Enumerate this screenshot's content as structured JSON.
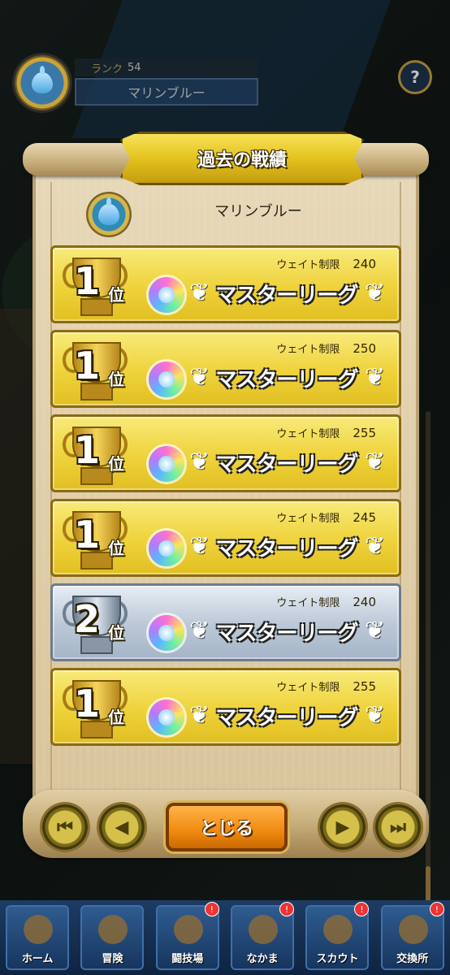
{
  "header": {
    "rank_label": "ランク",
    "rank_value": "54",
    "player_name": "マリンブルー",
    "help_label": "?"
  },
  "dialog": {
    "title": "過去の戦績",
    "player_name": "マリンブルー",
    "records": [
      {
        "rank": "1",
        "rank_suffix": "位",
        "weight_label": "ウェイト制限",
        "weight_value": "240",
        "league": "マスターリーグ",
        "tier": "gold"
      },
      {
        "rank": "1",
        "rank_suffix": "位",
        "weight_label": "ウェイト制限",
        "weight_value": "250",
        "league": "マスターリーグ",
        "tier": "gold"
      },
      {
        "rank": "1",
        "rank_suffix": "位",
        "weight_label": "ウェイト制限",
        "weight_value": "255",
        "league": "マスターリーグ",
        "tier": "gold"
      },
      {
        "rank": "1",
        "rank_suffix": "位",
        "weight_label": "ウェイト制限",
        "weight_value": "245",
        "league": "マスターリーグ",
        "tier": "gold"
      },
      {
        "rank": "2",
        "rank_suffix": "位",
        "weight_label": "ウェイト制限",
        "weight_value": "240",
        "league": "マスターリーグ",
        "tier": "silver"
      },
      {
        "rank": "1",
        "rank_suffix": "位",
        "weight_label": "ウェイト制限",
        "weight_value": "255",
        "league": "マスターリーグ",
        "tier": "gold"
      }
    ],
    "close_label": "とじる",
    "nav": {
      "first_icon": "skip-first-icon",
      "prev_icon": "prev-icon",
      "next_icon": "next-icon",
      "last_icon": "skip-last-icon"
    }
  },
  "tabbar": {
    "tabs": [
      {
        "label": "ホーム",
        "icon": "home-icon",
        "badge": ""
      },
      {
        "label": "冒険",
        "icon": "adventure-icon",
        "badge": ""
      },
      {
        "label": "闘技場",
        "icon": "arena-icon",
        "badge": "!"
      },
      {
        "label": "なかま",
        "icon": "party-icon",
        "badge": "!"
      },
      {
        "label": "スカウト",
        "icon": "scout-icon",
        "badge": "!"
      },
      {
        "label": "交換所",
        "icon": "exchange-icon",
        "badge": "!"
      }
    ]
  }
}
